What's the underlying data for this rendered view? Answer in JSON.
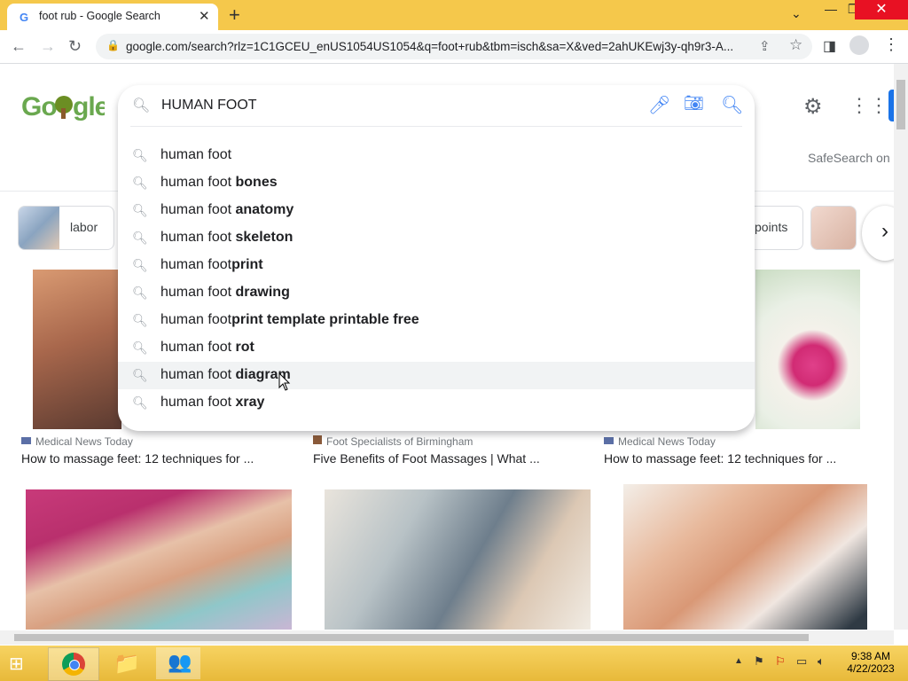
{
  "browser": {
    "tab_title": "foot rub - Google Search",
    "tab_favicon": "G",
    "url": "google.com/search?rlz=1C1GCEU_enUS1054US1054&q=foot+rub&tbm=isch&sa=X&ved=2ahUKEwj3y-qh9r3-A...",
    "accent_color": "#f5c84b"
  },
  "search": {
    "query": "HUMAN FOOT",
    "suggestions": [
      {
        "prefix": "human foot",
        "bold": ""
      },
      {
        "prefix": "human foot ",
        "bold": "bones"
      },
      {
        "prefix": "human foot ",
        "bold": "anatomy"
      },
      {
        "prefix": "human foot ",
        "bold": "skeleton"
      },
      {
        "prefix": "human foot",
        "bold": "print"
      },
      {
        "prefix": "human foot ",
        "bold": "drawing"
      },
      {
        "prefix": "human foot",
        "bold": "print template printable free"
      },
      {
        "prefix": "human foot ",
        "bold": "rot"
      },
      {
        "prefix": "human foot ",
        "bold": "diagram"
      },
      {
        "prefix": "human foot ",
        "bold": "xray"
      }
    ],
    "highlighted_index": 8
  },
  "page": {
    "safesearch": "SafeSearch on",
    "chips": [
      {
        "label": "labor"
      },
      {
        "label": "points"
      }
    ],
    "results_row1": [
      {
        "source": "Medical News Today",
        "title": "How to massage feet: 12 techniques for ..."
      },
      {
        "source": "Foot Specialists of Birmingham",
        "title": "Five Benefits of Foot Massages | What ..."
      },
      {
        "source": "Medical News Today",
        "title": "How to massage feet: 12 techniques for ..."
      }
    ]
  },
  "taskbar": {
    "time": "9:38 AM",
    "date": "4/22/2023"
  }
}
